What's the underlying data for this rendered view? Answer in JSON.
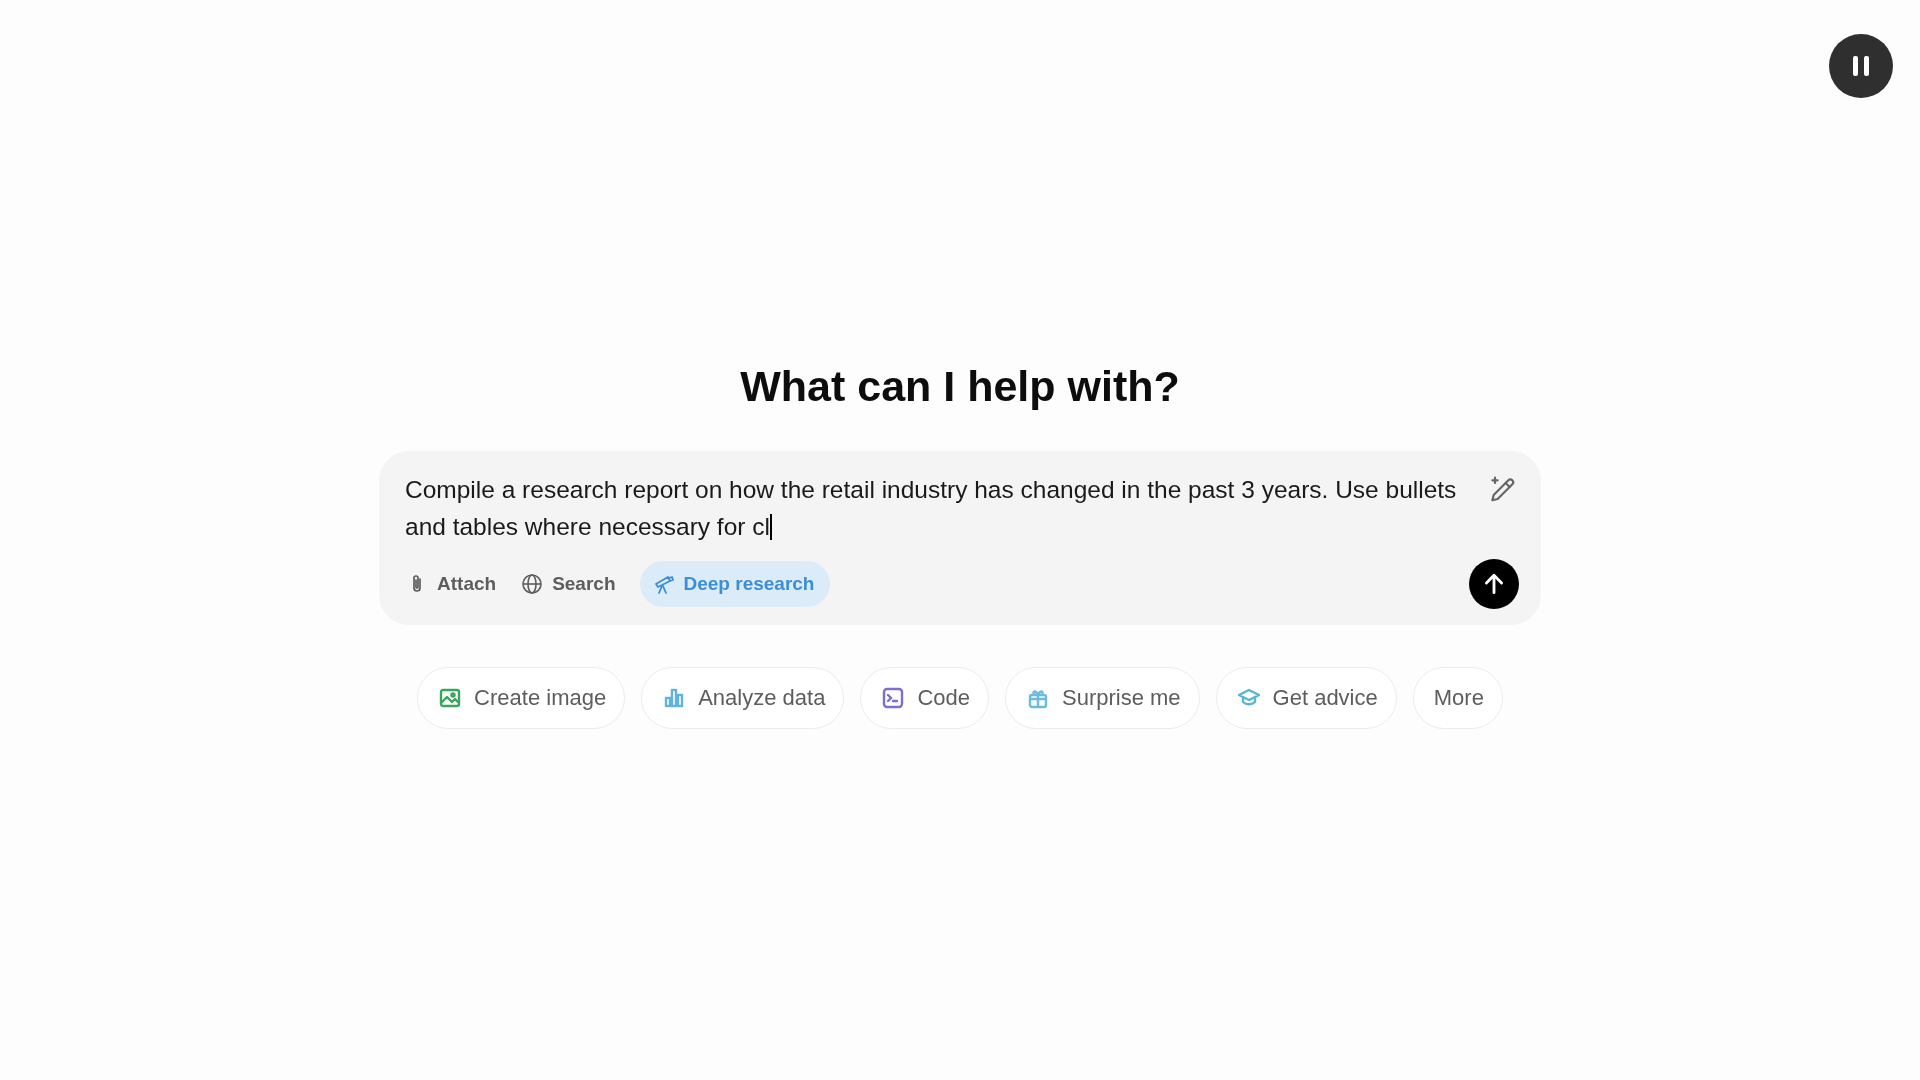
{
  "heading": "What can I help with?",
  "composer": {
    "value": "Compile a research report on how the retail industry has changed in the past 3 years. Use bullets and tables where necessary for cl",
    "tools": [
      {
        "kind": "attach",
        "label": "Attach",
        "selected": false
      },
      {
        "kind": "search",
        "label": "Search",
        "selected": false
      },
      {
        "kind": "research",
        "label": "Deep research",
        "selected": true
      }
    ]
  },
  "suggestions": [
    {
      "kind": "image",
      "label": "Create image",
      "color": "#3aa55c"
    },
    {
      "kind": "chart",
      "label": "Analyze data",
      "color": "#5fb3dc"
    },
    {
      "kind": "code",
      "label": "Code",
      "color": "#7b6fd0"
    },
    {
      "kind": "gift",
      "label": "Surprise me",
      "color": "#6bbbe0"
    },
    {
      "kind": "cap",
      "label": "Get advice",
      "color": "#58b6cf"
    },
    {
      "kind": "more",
      "label": "More"
    }
  ]
}
